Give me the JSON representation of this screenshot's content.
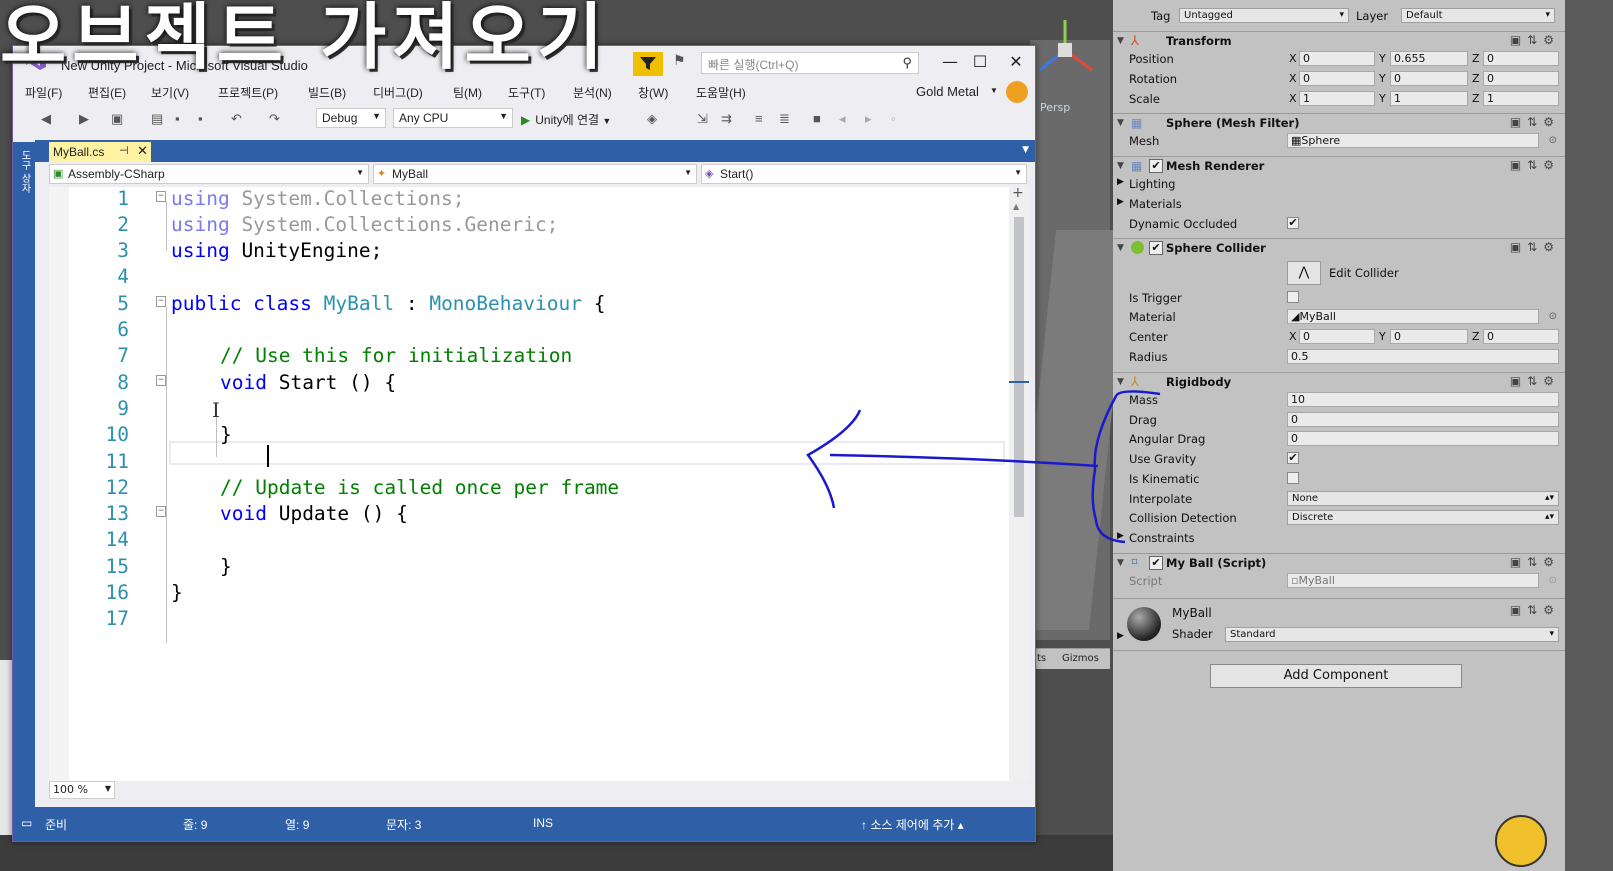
{
  "overlay": {
    "title": "오브젝트 가져오기"
  },
  "vs": {
    "title": "New Unity Project - Microsoft Visual Studio",
    "quick_launch_placeholder": "빠른 실행(Ctrl+Q)",
    "menu": [
      "파일(F)",
      "편집(E)",
      "보기(V)",
      "프로젝트(P)",
      "빌드(B)",
      "디버그(D)",
      "팀(M)",
      "도구(T)",
      "분석(N)",
      "창(W)",
      "도움말(H)"
    ],
    "user": "Gold Metal",
    "toolbar": {
      "config": "Debug",
      "platform": "Any CPU",
      "attach": "Unity에 연결"
    },
    "side_rail": "도구 상자",
    "tab": {
      "filename": "MyBall.cs",
      "pin": "⊣",
      "close": "✕"
    },
    "nav": {
      "project": "Assembly-CSharp",
      "class": "MyBall",
      "member": "Start()"
    },
    "zoom": "100 %",
    "status": {
      "ready": "준비",
      "line": "줄: 9",
      "col": "열: 9",
      "char": "문자: 3",
      "mode": "INS",
      "source_control": "소스 제어에 추가"
    }
  },
  "code": {
    "line_numbers": [
      "1",
      "2",
      "3",
      "4",
      "5",
      "6",
      "7",
      "8",
      "9",
      "10",
      "11",
      "12",
      "13",
      "14",
      "15",
      "16",
      "17"
    ],
    "l1_kw": "using",
    "l1_rest": " System.Collections;",
    "l2_kw": "using",
    "l2_rest": " System.Collections.Generic;",
    "l3_kw": "using",
    "l3_rest": " UnityEngine;",
    "l5_kw": "public class",
    "l5_cls": "MyBall",
    "l5_colon": " : ",
    "l5_base": "MonoBehaviour",
    "l5_brace": " {",
    "l7_cm": "// Use this for initialization",
    "l8_kw": "void",
    "l8_rest": " Start () {",
    "l10": "}",
    "l12_cm": "// Update is called once per frame",
    "l13_kw": "void",
    "l13_rest": " Update () {",
    "l15": "}",
    "l16": "}"
  },
  "scene": {
    "persp": "Persp",
    "gizmos_left": "ts",
    "gizmos": "Gizmos"
  },
  "inspector": {
    "tag_label": "Tag",
    "tag_value": "Untagged",
    "layer_label": "Layer",
    "layer_value": "Default",
    "transform": {
      "title": "Transform",
      "position_label": "Position",
      "rotation_label": "Rotation",
      "scale_label": "Scale",
      "position": {
        "x": "0",
        "y": "0.655",
        "z": "0"
      },
      "rotation": {
        "x": "0",
        "y": "0",
        "z": "0"
      },
      "scale": {
        "x": "1",
        "y": "1",
        "z": "1"
      }
    },
    "mesh_filter": {
      "title": "Sphere (Mesh Filter)",
      "mesh_label": "Mesh",
      "mesh_value": "Sphere"
    },
    "mesh_renderer": {
      "title": "Mesh Renderer",
      "lighting": "Lighting",
      "materials": "Materials",
      "dynamic_occluded": "Dynamic Occluded"
    },
    "sphere_collider": {
      "title": "Sphere Collider",
      "edit_collider": "Edit Collider",
      "is_trigger": "Is Trigger",
      "material_label": "Material",
      "material_value": "MyBall",
      "center_label": "Center",
      "center": {
        "x": "0",
        "y": "0",
        "z": "0"
      },
      "radius_label": "Radius",
      "radius": "0.5"
    },
    "rigidbody": {
      "title": "Rigidbody",
      "mass_label": "Mass",
      "mass": "10",
      "drag_label": "Drag",
      "drag": "0",
      "angular_drag_label": "Angular Drag",
      "angular_drag": "0",
      "use_gravity": "Use Gravity",
      "is_kinematic": "Is Kinematic",
      "interpolate_label": "Interpolate",
      "interpolate": "None",
      "collision_label": "Collision Detection",
      "collision": "Discrete",
      "constraints": "Constraints"
    },
    "script": {
      "title": "My Ball (Script)",
      "script_label": "Script",
      "script_value": "MyBall"
    },
    "material": {
      "name": "MyBall",
      "shader_label": "Shader",
      "shader": "Standard"
    },
    "add_component": "Add Component",
    "axes": {
      "x": "X",
      "y": "Y",
      "z": "Z"
    }
  },
  "colors": {
    "vs_accent": "#2f5fa7",
    "keyword": "#0000ff",
    "type": "#2b91af",
    "comment": "#008000",
    "annotation": "#1a1acc",
    "inspector_bg": "#c2c2c2"
  }
}
